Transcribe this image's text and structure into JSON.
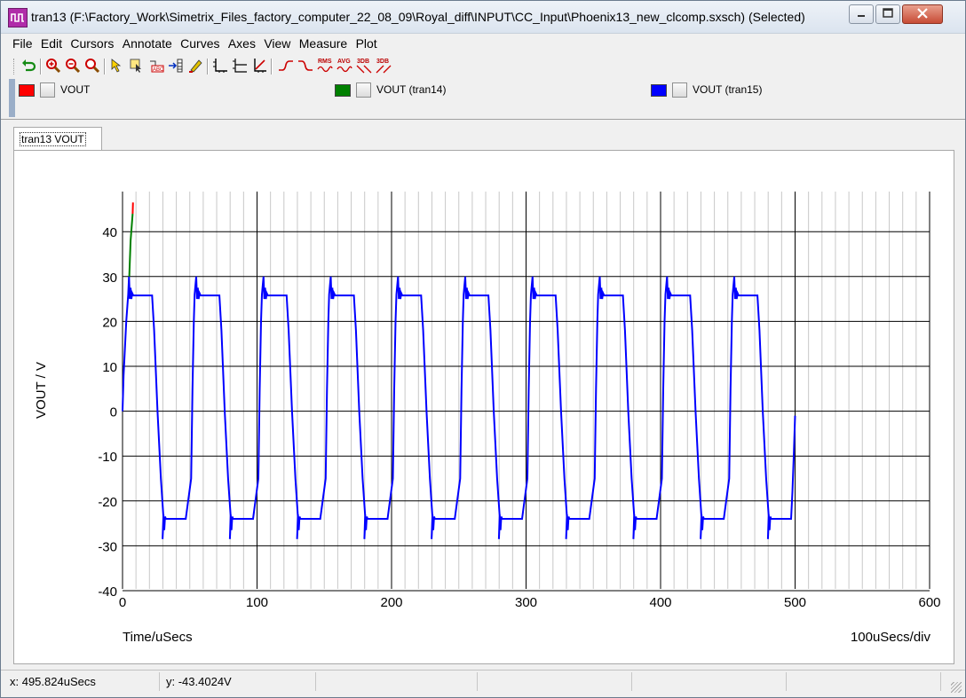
{
  "window": {
    "title": "tran13 (F:\\Factory_Work\\Simetrix_Files_factory_computer_22_08_09\\Royal_diff\\INPUT\\CC_Input\\Phoenix13_new_clcomp.sxsch) (Selected)"
  },
  "menu": [
    "File",
    "Edit",
    "Cursors",
    "Annotate",
    "Curves",
    "Axes",
    "View",
    "Measure",
    "Plot"
  ],
  "toolbar": {
    "icons": [
      "undo-icon",
      "zoom-in-icon",
      "zoom-out-icon",
      "zoom-full-icon",
      "cursor-icon",
      "select-icon",
      "abc-label-icon",
      "arrow-label-icon",
      "highlighter-icon",
      "axes-icon",
      "stacked-axes-icon",
      "grid-axes-icon",
      "rise-icon",
      "fall-icon",
      "rms-icon",
      "avg-icon",
      "3db-high-icon",
      "3db-low-icon"
    ],
    "text_labels": {
      "rms": "RMS",
      "avg": "AVG",
      "db1": "3DB",
      "db2": "3DB"
    }
  },
  "legend": [
    {
      "label": "VOUT",
      "color": "#ff0000"
    },
    {
      "label": "VOUT (tran14)",
      "color": "#008000"
    },
    {
      "label": "VOUT (tran15)",
      "color": "#0000ff"
    }
  ],
  "tab": {
    "label": "tran13 VOUT"
  },
  "chart_data": {
    "type": "line",
    "xlabel": "Time/uSecs",
    "ylabel": "VOUT / V",
    "x_scale_note": "100uSecs/div",
    "xlim": [
      0,
      600
    ],
    "ylim": [
      -40,
      45
    ],
    "x_ticks": [
      0,
      100,
      200,
      300,
      400,
      500,
      600
    ],
    "y_ticks": [
      -40,
      -30,
      -20,
      -10,
      0,
      10,
      20,
      30,
      40
    ],
    "grid": true,
    "series": [
      {
        "name": "VOUT",
        "color": "#ff0000",
        "x": [
          7.5,
          7.8
        ],
        "y": [
          44,
          46.5
        ]
      },
      {
        "name": "VOUT (tran14)",
        "color": "#008000",
        "x": [
          5,
          6,
          7.5
        ],
        "y": [
          30,
          38,
          44
        ]
      },
      {
        "name": "VOUT (tran15)",
        "color": "#0000ff",
        "waveform": {
          "period": 50,
          "cycles": 10,
          "x_end": 500,
          "high": 25.8,
          "low": -24,
          "overshoot_high": 30,
          "overshoot_low": -28.5,
          "rise_time": 3,
          "fall_time": 10,
          "high_end": 22,
          "low_end": 47,
          "start_y": 0
        }
      }
    ]
  },
  "status": {
    "x_readout": "x: 495.824uSecs",
    "y_readout": "y: -43.4024V"
  }
}
